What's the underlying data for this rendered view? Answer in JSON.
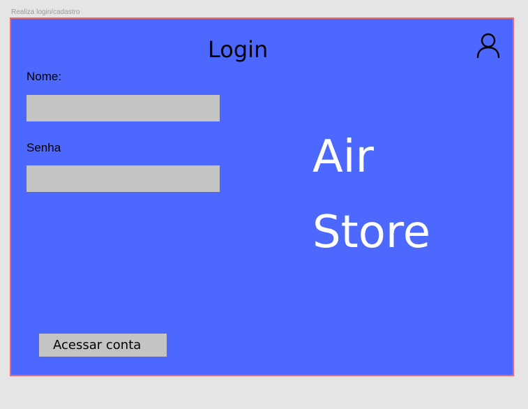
{
  "frame": {
    "label": "Realiza login/cadastro"
  },
  "login": {
    "title": "Login",
    "name_label": "Nome:",
    "name_value": "",
    "password_label": "Senha",
    "password_value": "",
    "submit_label": "Acessar conta"
  },
  "brand": {
    "line1": "Air",
    "line2": "Store"
  },
  "icons": {
    "user": "user-icon"
  },
  "colors": {
    "panel_background": "#4c68ff",
    "frame_border": "#ec6a6a",
    "input_background": "#c4c4c4",
    "button_background": "#c4c4c4",
    "brand_text": "#ffffff",
    "canvas_background": "#e5e5e5"
  }
}
